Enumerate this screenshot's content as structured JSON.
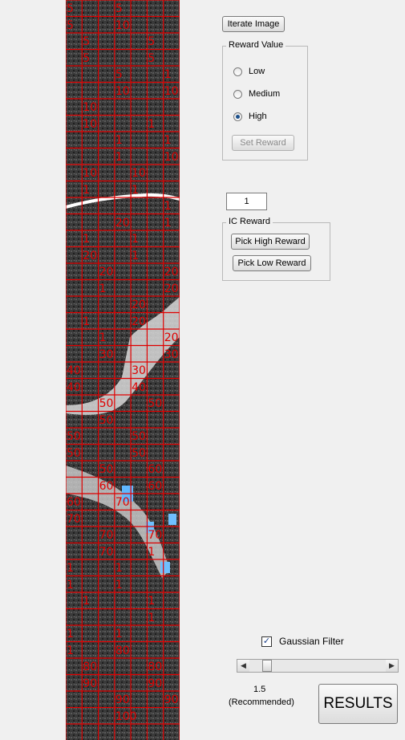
{
  "image_panel": {
    "labels": [
      "5",
      "5",
      "5",
      "10",
      "5",
      "5",
      "5",
      "5",
      "5",
      "1",
      "10",
      "10",
      "10",
      "1",
      "10",
      "1",
      "1",
      "1",
      "10",
      "10",
      "10",
      "1",
      "1",
      "1",
      "20",
      "1",
      "1",
      "1",
      "20",
      "1",
      "20",
      "20",
      "20",
      "1",
      "20",
      "1",
      "20",
      "20",
      "1",
      "30",
      "30",
      "30",
      "40",
      "40",
      "40",
      "50",
      "50",
      "50",
      "50",
      "50",
      "50",
      "50",
      "50",
      "60",
      "60",
      "60",
      "60",
      "70",
      "70",
      "70",
      "70",
      "70",
      "1",
      "1",
      "1",
      "1",
      "1",
      "1",
      "1",
      "1",
      "1",
      "1",
      "1",
      "80",
      "80",
      "80",
      "90",
      "90",
      "90",
      "90",
      "100"
    ]
  },
  "controls": {
    "iterate_button": "Iterate Image",
    "reward_group": {
      "title": "Reward Value",
      "options": [
        "Low",
        "Medium",
        "High"
      ],
      "selected": "High",
      "set_button": "Set Reward"
    },
    "counter_value": "1",
    "ic_group": {
      "title": "IC Reward",
      "high_button": "Pick High Reward",
      "low_button": "Pick Low Reward"
    },
    "gaussian": {
      "label": "Gaussian Filter",
      "checked": true
    },
    "slider": {
      "value_text": "1.5",
      "note": "(Recommended)",
      "position": 0.1
    },
    "results_button": "RESULTS"
  }
}
